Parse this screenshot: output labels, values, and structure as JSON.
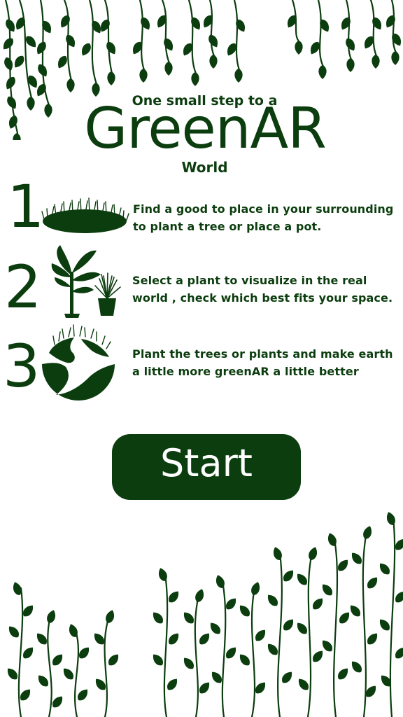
{
  "header": {
    "tagline_top": "One small step to a",
    "app_title": "GreenAR",
    "tagline_bottom": "World"
  },
  "steps": [
    {
      "number": "1",
      "illustration": "grass-patch-icon",
      "text": "Find a good to place in your surrounding to plant a tree or place a pot."
    },
    {
      "number": "2",
      "illustration": "potted-plants-icon",
      "text": "Select a plant to visualize in the real world , check which best fits your space."
    },
    {
      "number": "3",
      "illustration": "green-earth-icon",
      "text": "Plant the trees or plants and make earth a little more greenAR a little better"
    }
  ],
  "start_button": {
    "label": "Start"
  },
  "decorations": {
    "top": "hanging-vines-decoration",
    "bottom": "climbing-vines-decoration"
  },
  "colors": {
    "primary": "#0b3d0e",
    "background": "#ffffff",
    "button_text": "#ffffff"
  }
}
